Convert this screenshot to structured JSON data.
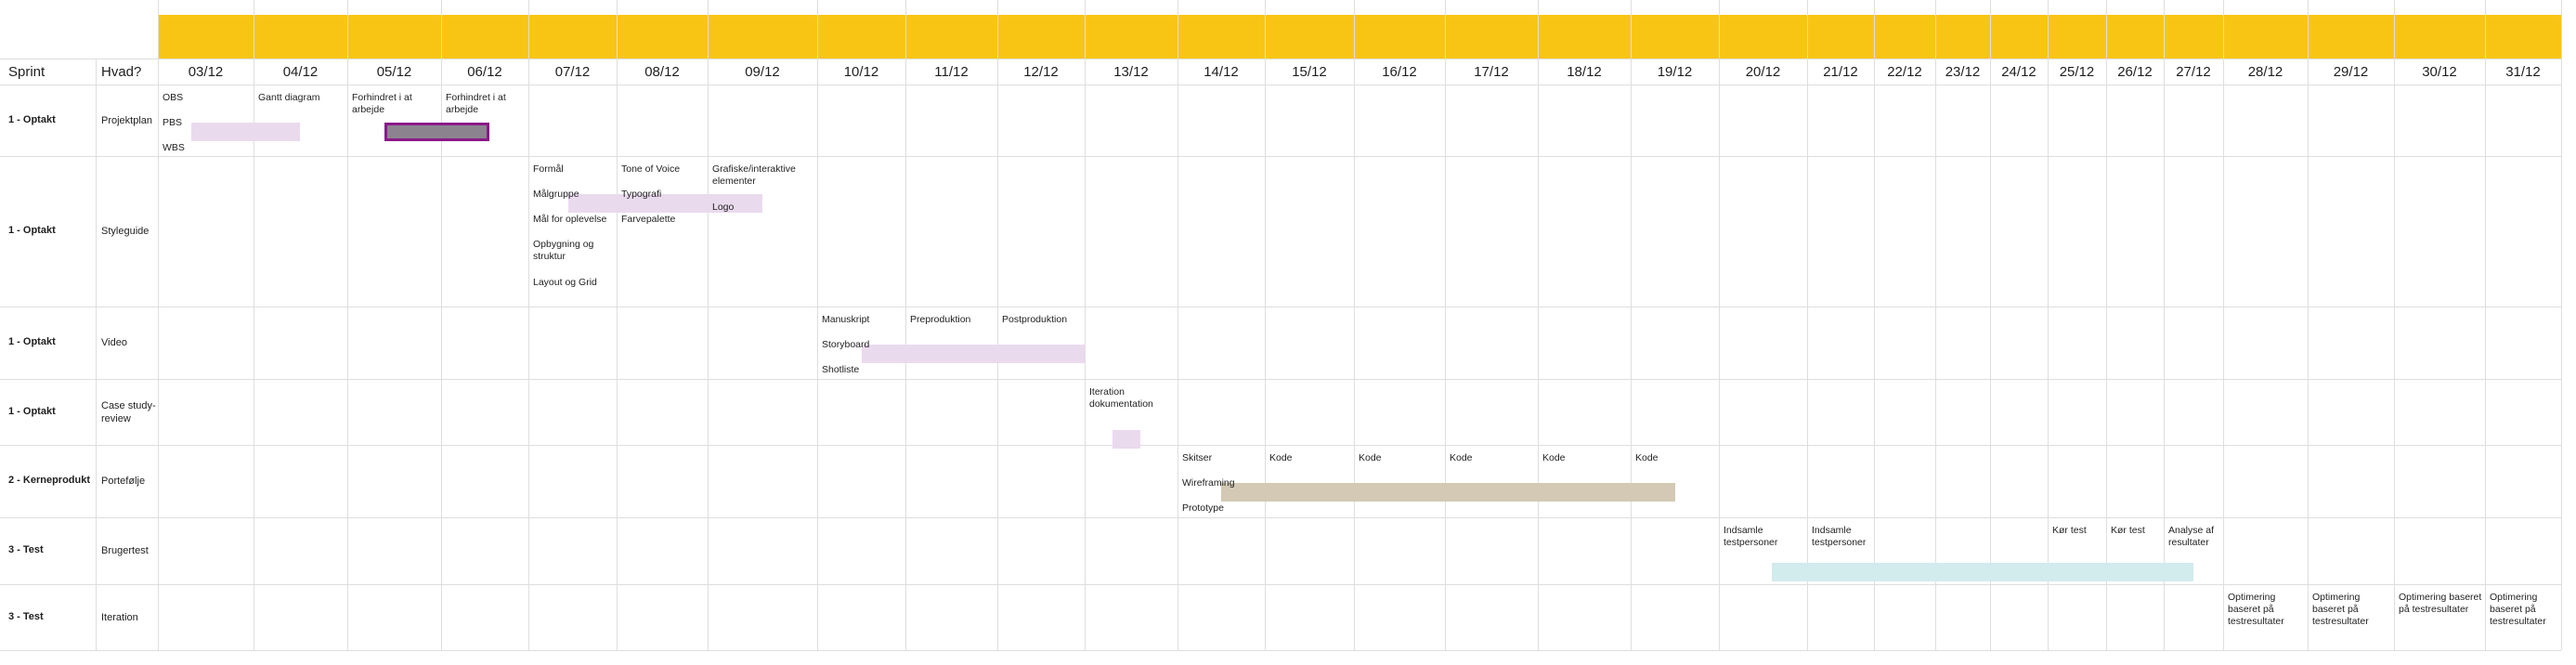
{
  "header": {
    "sprint_label": "Sprint",
    "hvad_label": "Hvad?",
    "dates": [
      "03/12",
      "04/12",
      "05/12",
      "06/12",
      "07/12",
      "08/12",
      "09/12",
      "10/12",
      "11/12",
      "12/12",
      "13/12",
      "14/12",
      "15/12",
      "16/12",
      "17/12",
      "18/12",
      "19/12",
      "20/12",
      "21/12",
      "22/12",
      "23/12",
      "24/12",
      "25/12",
      "26/12",
      "27/12",
      "28/12",
      "29/12",
      "30/12",
      "31/12"
    ],
    "band_color": "#f9c515"
  },
  "rows": [
    {
      "sprint": "1 - Optakt",
      "hvad": "Projektplan",
      "notes": [
        {
          "col": 0,
          "line": 0,
          "text": "OBS"
        },
        {
          "col": 0,
          "line": 1,
          "text": "PBS"
        },
        {
          "col": 0,
          "line": 2,
          "text": "WBS"
        },
        {
          "col": 1,
          "line": 0,
          "text": "Gantt diagram"
        },
        {
          "col": 2,
          "line": 0,
          "text": "Forhindret i at arbejde"
        },
        {
          "col": 3,
          "line": 0,
          "text": "Forhindret i at arbejde"
        }
      ],
      "bars": [
        {
          "from": 0.35,
          "to": 1.5,
          "line": 1,
          "color": "#eadaee"
        },
        {
          "from": 2.4,
          "to": 3.55,
          "line": 1,
          "color": "#8b848f",
          "outline": "#8a1a8a"
        }
      ]
    },
    {
      "sprint": "1 - Optakt",
      "hvad": "Styleguide",
      "notes": [
        {
          "col": 4,
          "line": 0,
          "text": "Formål"
        },
        {
          "col": 4,
          "line": 1,
          "text": "Målgruppe"
        },
        {
          "col": 4,
          "line": 2,
          "text": "Mål for oplevelse"
        },
        {
          "col": 4,
          "line": 3,
          "text": "Opbygning og struktur"
        },
        {
          "col": 4,
          "line": 4.5,
          "text": "Layout og Grid"
        },
        {
          "col": 5,
          "line": 0,
          "text": "Tone of Voice"
        },
        {
          "col": 5,
          "line": 1,
          "text": "Typografi"
        },
        {
          "col": 5,
          "line": 2,
          "text": "Farvepalette"
        },
        {
          "col": 6,
          "line": 0,
          "text": "Grafiske/interaktive elementer"
        },
        {
          "col": 6,
          "line": 1.5,
          "text": "Logo"
        }
      ],
      "bars": [
        {
          "from": 4.45,
          "to": 6.5,
          "line": 1,
          "color": "#eadaee"
        }
      ]
    },
    {
      "sprint": "1 - Optakt",
      "hvad": "Video",
      "notes": [
        {
          "col": 7,
          "line": 0,
          "text": "Manuskript"
        },
        {
          "col": 7,
          "line": 1,
          "text": "Storyboard"
        },
        {
          "col": 7,
          "line": 2,
          "text": "Shotliste"
        },
        {
          "col": 8,
          "line": 0,
          "text": "Preproduktion"
        },
        {
          "col": 9,
          "line": 0,
          "text": "Postproduktion"
        }
      ],
      "bars": [
        {
          "from": 7.5,
          "to": 10.0,
          "line": 1,
          "color": "#eadaee"
        }
      ]
    },
    {
      "sprint": "1 - Optakt",
      "hvad": "Case study-review",
      "notes": [
        {
          "col": 10,
          "line": 0,
          "text": "Iteration dokumentation"
        }
      ],
      "bars": [
        {
          "from": 10.3,
          "to": 10.6,
          "line": 1.5,
          "color": "#eadaee"
        }
      ]
    },
    {
      "sprint": "2 - Kerneprodukt",
      "hvad": "Portefølje",
      "notes": [
        {
          "col": 11,
          "line": 0,
          "text": "Skitser"
        },
        {
          "col": 11,
          "line": 1,
          "text": "Wireframing"
        },
        {
          "col": 11,
          "line": 2,
          "text": "Prototype"
        },
        {
          "col": 12,
          "line": 0,
          "text": "Kode"
        },
        {
          "col": 13,
          "line": 0,
          "text": "Kode"
        },
        {
          "col": 14,
          "line": 0,
          "text": "Kode"
        },
        {
          "col": 15,
          "line": 0,
          "text": "Kode"
        },
        {
          "col": 16,
          "line": 0,
          "text": "Kode"
        }
      ],
      "bars": [
        {
          "from": 11.5,
          "to": 16.5,
          "line": 1,
          "color": "#d3c9b5"
        }
      ]
    },
    {
      "sprint": "3 - Test",
      "hvad": "Brugertest",
      "notes": [
        {
          "col": 17,
          "line": 0,
          "text": "Indsamle testpersoner"
        },
        {
          "col": 18,
          "line": 0,
          "text": "Indsamle testpersoner"
        },
        {
          "col": 22,
          "line": 0,
          "text": "Kør test"
        },
        {
          "col": 23,
          "line": 0,
          "text": "Kør test"
        },
        {
          "col": 24,
          "line": 0,
          "text": "Analyse af resultater"
        }
      ],
      "bars": [
        {
          "from": 17.6,
          "to": 24.5,
          "line": 1.3,
          "color": "#d2ebec"
        }
      ]
    },
    {
      "sprint": "3 - Test",
      "hvad": "Iteration",
      "notes": [
        {
          "col": 25,
          "line": 0,
          "text": "Optimering baseret på testresultater"
        },
        {
          "col": 26,
          "line": 0,
          "text": "Optimering baseret på testresultater"
        },
        {
          "col": 27,
          "line": 0,
          "text": "Optimering baseret på testresultater"
        },
        {
          "col": 28,
          "line": 0,
          "text": "Optimering baseret på testresultater"
        }
      ],
      "bars": []
    }
  ]
}
